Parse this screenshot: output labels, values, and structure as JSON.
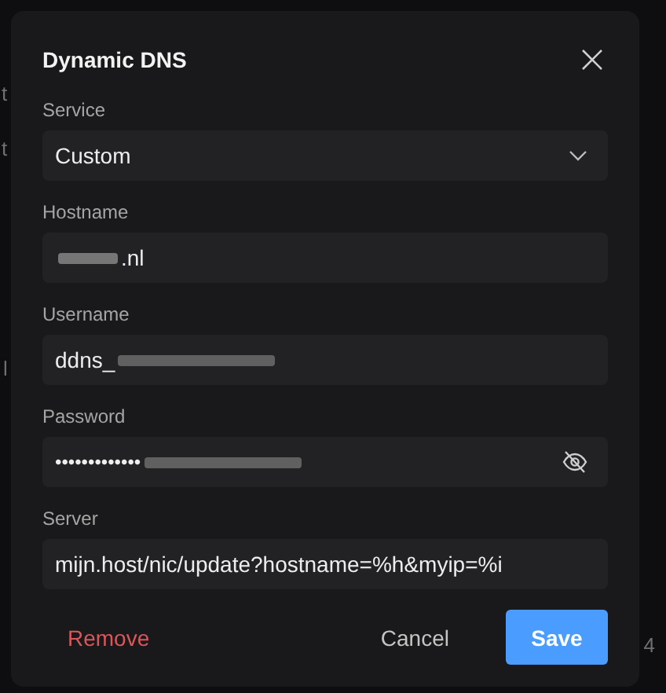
{
  "background": {
    "fragments": [
      {
        "text": "t"
      },
      {
        "text": "t"
      },
      {
        "text": "l"
      },
      {
        "text": "4"
      }
    ]
  },
  "dialog": {
    "title": "Dynamic DNS",
    "fields": [
      {
        "kind": "select",
        "label": "Service",
        "value": "Custom"
      },
      {
        "kind": "text",
        "label": "Hostname",
        "value": ".nl",
        "blur_before": true
      },
      {
        "kind": "text",
        "label": "Username",
        "value": "ddns_",
        "blur_after": true
      },
      {
        "kind": "password",
        "label": "Password",
        "value": "•••••••••••••",
        "blur_after": true,
        "revealed": false
      },
      {
        "kind": "text",
        "label": "Server",
        "value": "mijn.host/nic/update?hostname=%h&myip=%i"
      }
    ],
    "buttons": [
      {
        "kind": "danger",
        "label": "Remove"
      },
      {
        "kind": "plain",
        "label": "Cancel"
      },
      {
        "kind": "primary",
        "label": "Save"
      }
    ]
  }
}
